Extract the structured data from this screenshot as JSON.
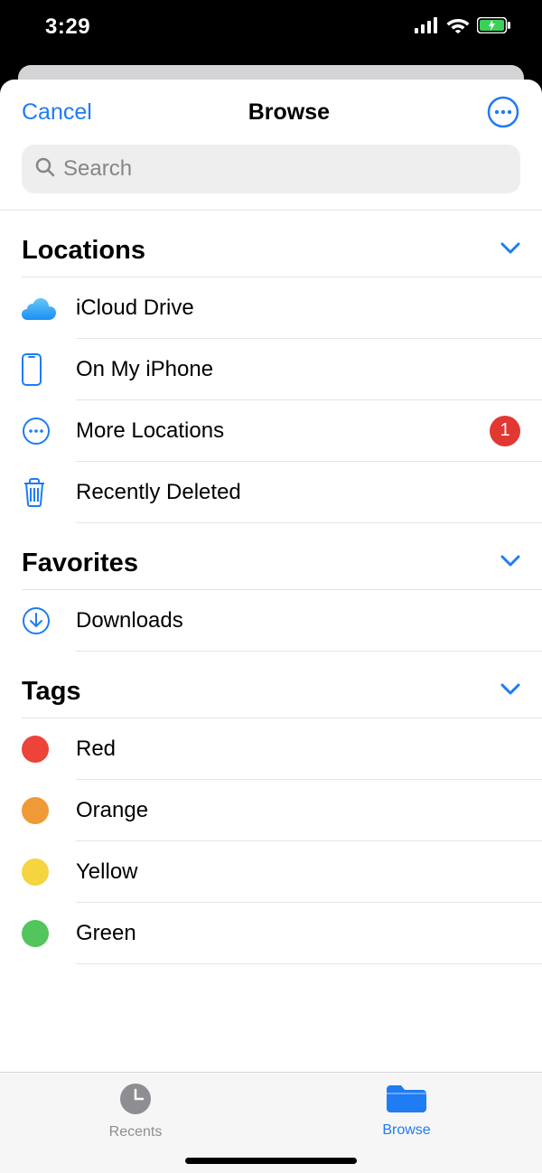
{
  "status": {
    "time": "3:29"
  },
  "nav": {
    "cancel": "Cancel",
    "title": "Browse"
  },
  "search": {
    "placeholder": "Search"
  },
  "sections": {
    "locations": {
      "title": "Locations",
      "items": [
        {
          "label": "iCloud Drive"
        },
        {
          "label": "On My iPhone"
        },
        {
          "label": "More Locations",
          "badge": "1"
        },
        {
          "label": "Recently Deleted"
        }
      ]
    },
    "favorites": {
      "title": "Favorites",
      "items": [
        {
          "label": "Downloads"
        }
      ]
    },
    "tags": {
      "title": "Tags",
      "items": [
        {
          "label": "Red",
          "color": "#ec4439"
        },
        {
          "label": "Orange",
          "color": "#f09a37"
        },
        {
          "label": "Yellow",
          "color": "#f4d53f"
        },
        {
          "label": "Green",
          "color": "#52c55c"
        }
      ]
    }
  },
  "tabs": {
    "recents": "Recents",
    "browse": "Browse"
  }
}
